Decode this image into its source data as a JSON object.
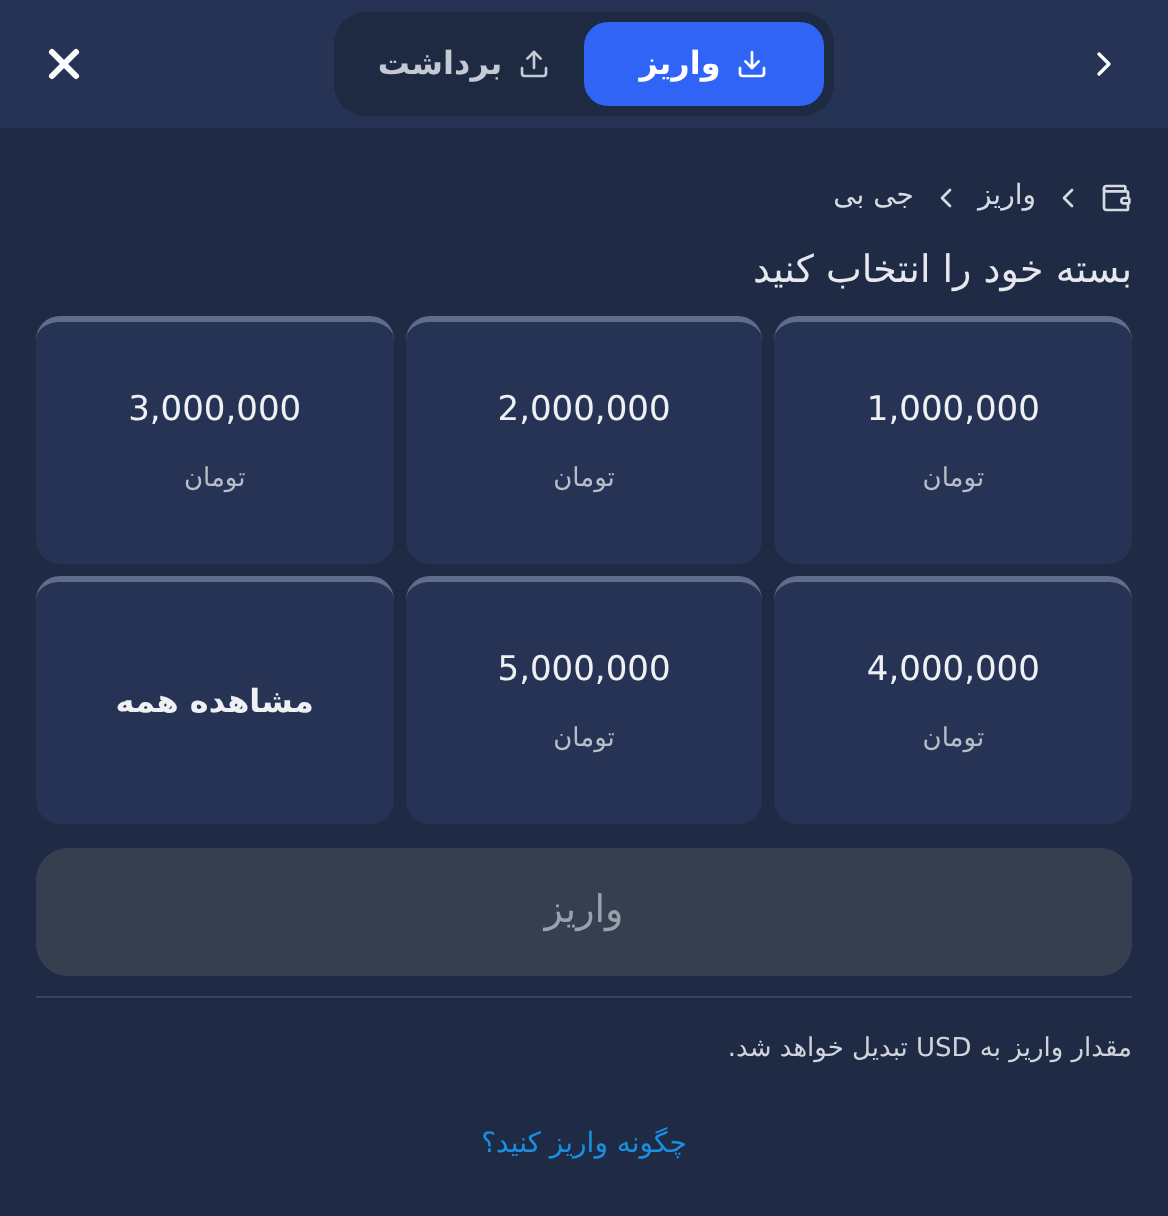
{
  "tabs": [
    {
      "label": "واریز",
      "kind": "deposit",
      "selected": true
    },
    {
      "label": "برداشت",
      "kind": "withdraw",
      "selected": false
    }
  ],
  "breadcrumb": [
    "واریز",
    "جی بی"
  ],
  "heading": "بسته خود را انتخاب کنید",
  "packages": [
    {
      "kind": "amount",
      "amount": "1,000,000",
      "unit": "تومان"
    },
    {
      "kind": "amount",
      "amount": "2,000,000",
      "unit": "تومان"
    },
    {
      "kind": "amount",
      "amount": "3,000,000",
      "unit": "تومان"
    },
    {
      "kind": "amount",
      "amount": "4,000,000",
      "unit": "تومان"
    },
    {
      "kind": "amount",
      "amount": "5,000,000",
      "unit": "تومان"
    },
    {
      "kind": "view_all",
      "label": "مشاهده همه"
    }
  ],
  "submit": {
    "label": "واریز",
    "disabled": true
  },
  "note": "مقدار واریز به USD تبدیل خواهد شد.",
  "help_link": "چگونه واریز کنید؟"
}
